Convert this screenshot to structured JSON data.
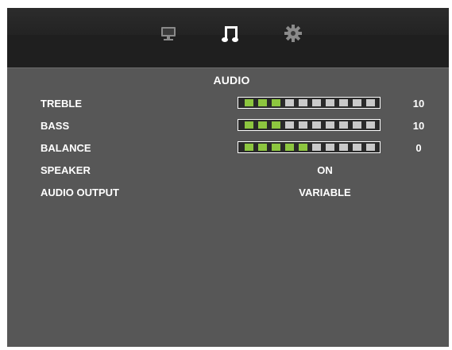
{
  "tabs": [
    {
      "name": "picture",
      "icon": "monitor-icon",
      "active": false
    },
    {
      "name": "audio",
      "icon": "music-note-icon",
      "active": true
    },
    {
      "name": "setup",
      "icon": "gear-icon",
      "active": false
    }
  ],
  "menu": {
    "title": "AUDIO",
    "rows": [
      {
        "label": "TREBLE",
        "value": "10",
        "level_segments": 3,
        "total_segments": 10
      },
      {
        "label": "BASS",
        "value": "10",
        "level_segments": 3,
        "total_segments": 10
      },
      {
        "label": "BALANCE",
        "value": "0",
        "level_segments": 5,
        "total_segments": 10
      },
      {
        "label": "SPEAKER",
        "value": "ON"
      },
      {
        "label": "AUDIO OUTPUT",
        "value": "VARIABLE"
      }
    ]
  },
  "colors": {
    "panel": "#575757",
    "header": "#1f1f1f",
    "active_segment": "#8dc63f",
    "inactive_segment": "#c9c9c9",
    "active_icon": "#ffffff",
    "inactive_icon": "#8a8a8a"
  }
}
